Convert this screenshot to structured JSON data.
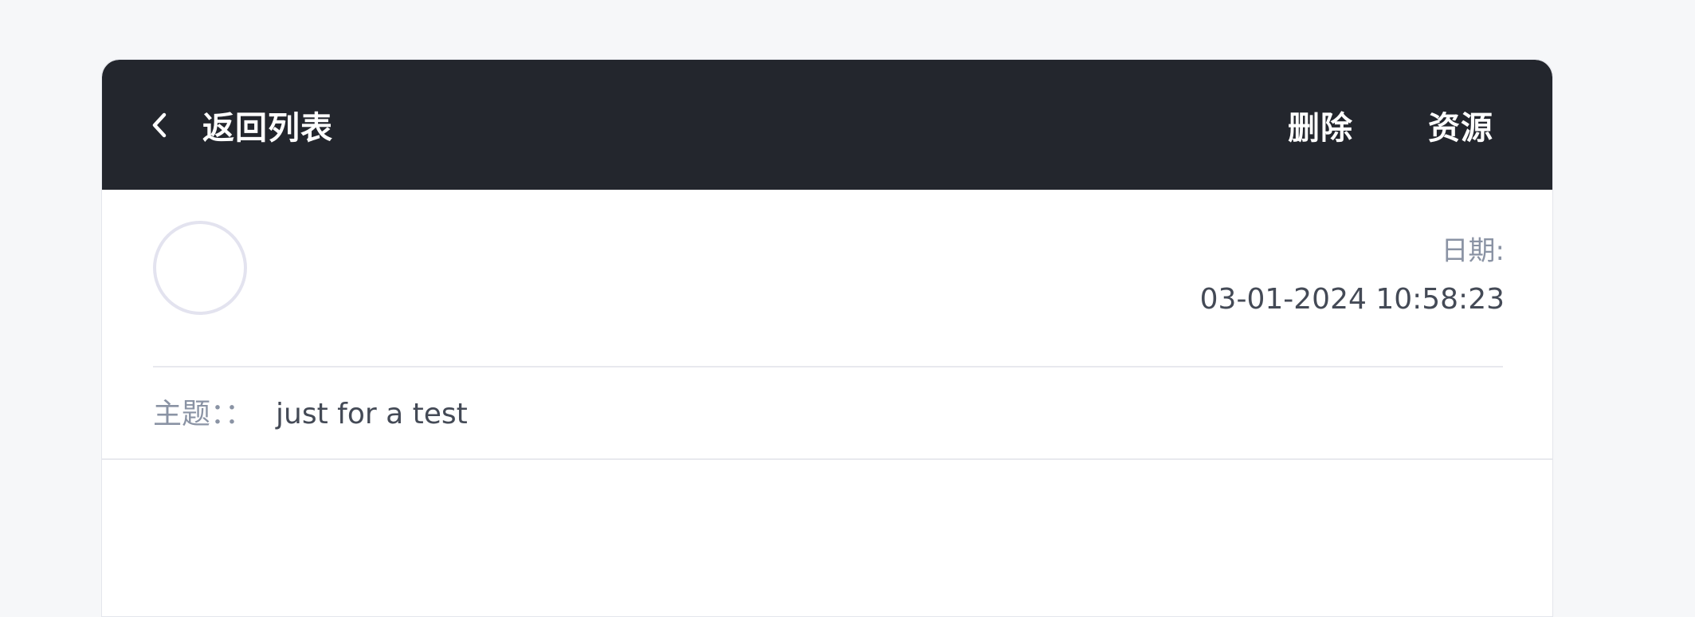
{
  "header": {
    "back_label": "返回列表",
    "back_icon": "chevron-left-icon",
    "delete_label": "删除",
    "resource_label": "资源"
  },
  "message": {
    "date_label": "日期:",
    "date_value": "03-01-2024 10:58:23",
    "subject_label": "主题：：",
    "subject_value": "just for a test"
  },
  "colors": {
    "page_background": "#f6f7f9",
    "header_background": "#23262d",
    "card_background": "#ffffff",
    "muted_text": "#8a93a4",
    "primary_text": "#444a56",
    "avatar_border": "#e3e3ef"
  }
}
